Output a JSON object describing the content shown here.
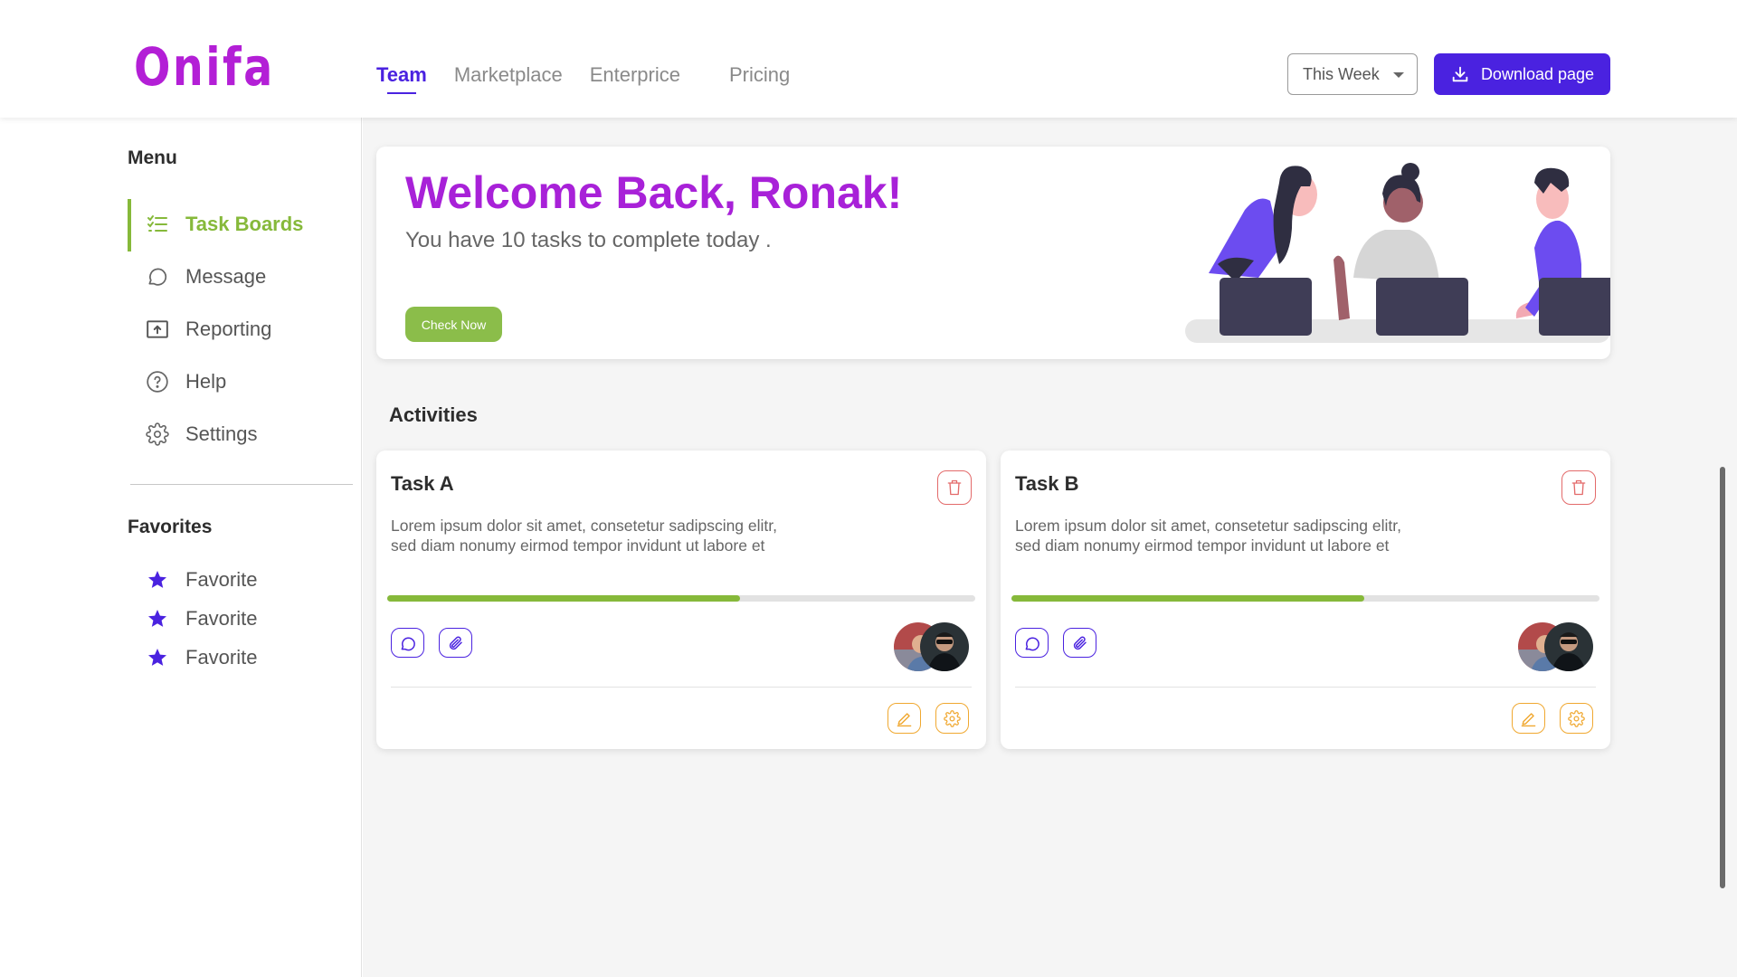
{
  "brand": {
    "logo": "Onifa",
    "accent": "#4a22e0",
    "logo_color": "#b31fd6",
    "green": "#86b93a"
  },
  "nav": {
    "items": [
      "Team",
      "Marketplace",
      "Enterprice",
      "Pricing"
    ],
    "active": "Team"
  },
  "header": {
    "period_select": "This Week",
    "download_label": "Download page"
  },
  "sidebar": {
    "menu_title": "Menu",
    "menu": [
      {
        "label": "Task Boards",
        "icon": "list-check-icon",
        "active": true
      },
      {
        "label": "Message",
        "icon": "chat-icon"
      },
      {
        "label": "Reporting",
        "icon": "upload-box-icon"
      },
      {
        "label": "Help",
        "icon": "help-circle-icon"
      },
      {
        "label": "Settings",
        "icon": "gear-icon"
      }
    ],
    "favorites_title": "Favorites",
    "favorites": [
      {
        "label": "Favorite",
        "icon": "star-icon"
      },
      {
        "label": "Favorite",
        "icon": "star-icon"
      },
      {
        "label": "Favorite",
        "icon": "star-icon"
      }
    ]
  },
  "welcome": {
    "title": "Welcome Back, Ronak!",
    "subtitle": "You have 10 tasks to complete today .",
    "button": "Check Now"
  },
  "activities": {
    "title": "Activities",
    "tasks": [
      {
        "title": "Task A",
        "desc_line1": "Lorem ipsum dolor sit amet, consetetur sadipscing elitr,",
        "desc_line2": "sed diam nonumy eirmod tempor invidunt ut labore et",
        "progress": 0.6
      },
      {
        "title": "Task B",
        "desc_line1": "Lorem ipsum dolor sit amet, consetetur sadipscing elitr,",
        "desc_line2": "sed diam nonumy eirmod tempor invidunt ut labore et",
        "progress": 0.6
      }
    ]
  }
}
